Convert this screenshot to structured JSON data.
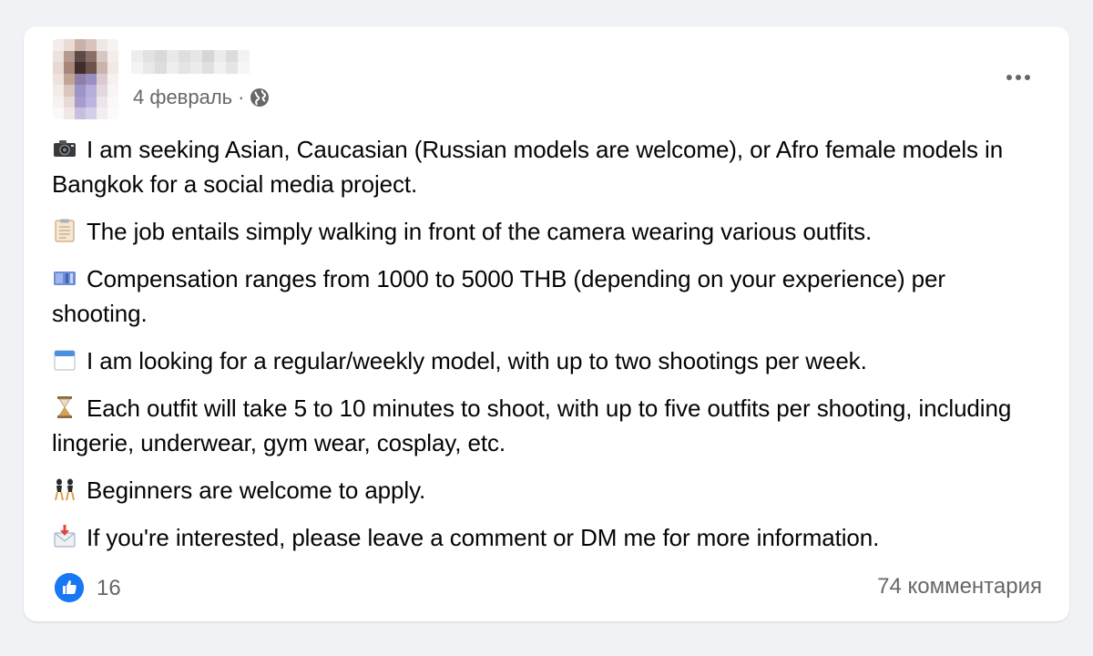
{
  "post": {
    "author_name": "",
    "date": "4 февраль",
    "separator": "·",
    "paragraphs": [
      {
        "icon": "camera-icon",
        "text": "I am seeking Asian, Caucasian (Russian models are welcome), or Afro female models in Bangkok for a social media project."
      },
      {
        "icon": "clipboard-icon",
        "text": "The job entails simply walking in front of the camera wearing various outfits."
      },
      {
        "icon": "money-icon",
        "text": "Compensation ranges from 1000 to 5000 THB (depending on your experience) per shooting."
      },
      {
        "icon": "calendar-icon",
        "text": "I am looking for a regular/weekly model, with up to two shootings per week."
      },
      {
        "icon": "hourglass-icon",
        "text": "Each outfit will take 5 to 10 minutes to shoot, with up to five outfits per shooting, including lingerie, underwear, gym wear, cosplay, etc."
      },
      {
        "icon": "dancers-icon",
        "text": "Beginners are welcome to apply."
      },
      {
        "icon": "inbox-icon",
        "text": "If you're interested, please leave a comment or DM me for more information."
      }
    ]
  },
  "reactions": {
    "like_count": "16",
    "comments_label": "74 комментария"
  },
  "colors": {
    "background": "#f0f2f5",
    "card": "#ffffff",
    "secondary_text": "#65676b",
    "like_blue": "#1877f2"
  }
}
